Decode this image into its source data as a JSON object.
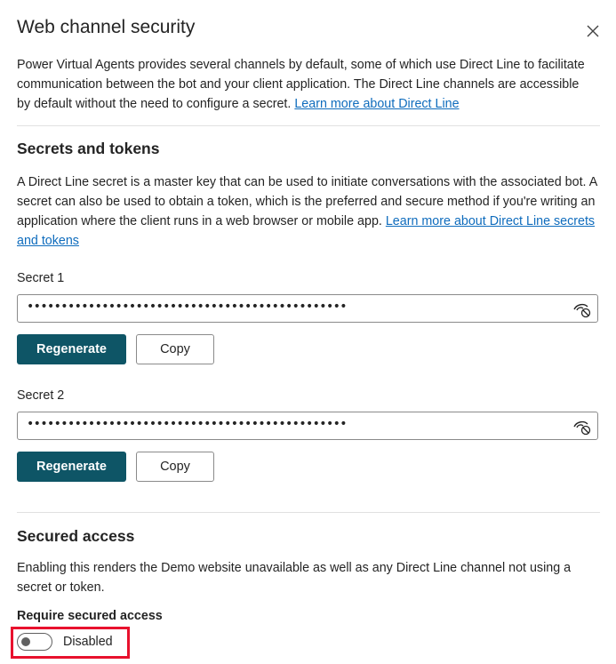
{
  "panel": {
    "title": "Web channel security",
    "close_icon": "close-icon",
    "intro_text": "Power Virtual Agents provides several channels by default, some of which use Direct Line to facilitate communication between the bot and your client application. The Direct Line channels are accessible by default without the need to configure a secret.",
    "intro_link": "Learn more about Direct Line"
  },
  "secrets": {
    "heading": "Secrets and tokens",
    "description": "A Direct Line secret is a master key that can be used to initiate conversations with the associated bot. A secret can also be used to obtain a token, which is the preferred and secure method if you're writing an application where the client runs in a web browser or mobile app.",
    "link": "Learn more about Direct Line secrets and tokens",
    "secret1": {
      "label": "Secret 1",
      "masked_value": "••••••••••••••••••••••••••••••••••••••••••••••••••••",
      "toggle_icon": "eye-hidden-icon",
      "regenerate_label": "Regenerate",
      "copy_label": "Copy"
    },
    "secret2": {
      "label": "Secret 2",
      "masked_value": "••••••••••••••••••••••••••••••••••••••••••••••••••••",
      "toggle_icon": "eye-hidden-icon",
      "regenerate_label": "Regenerate",
      "copy_label": "Copy"
    }
  },
  "secured_access": {
    "heading": "Secured access",
    "description": "Enabling this renders the Demo website unavailable as well as any Direct Line channel not using a secret or token.",
    "toggle_label": "Require secured access",
    "toggle_state": "Disabled",
    "toggle_on": false
  },
  "colors": {
    "primary_button": "#0e5566",
    "link": "#0f6cbd",
    "highlight": "#e8112d"
  }
}
